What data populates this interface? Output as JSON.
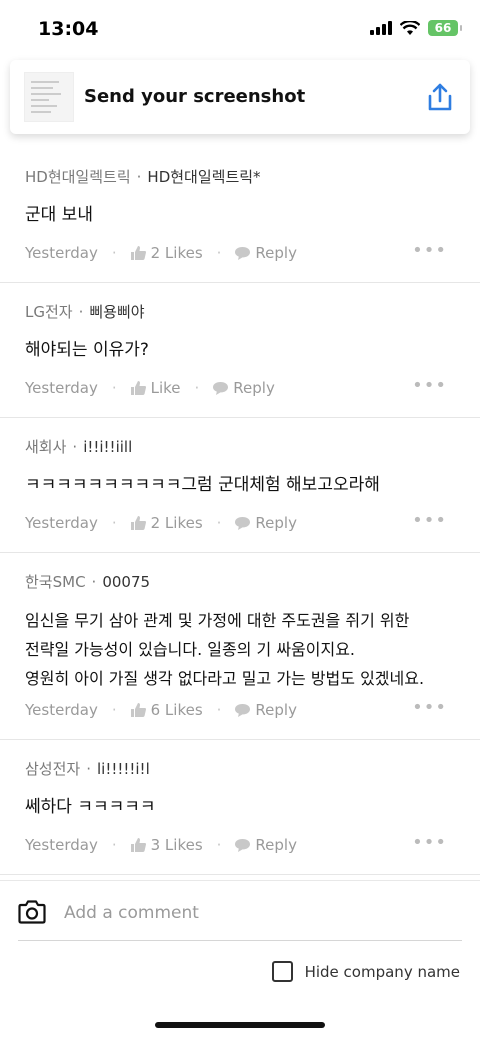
{
  "status": {
    "time": "13:04",
    "battery": "66"
  },
  "header": {
    "title": "Send your screenshot"
  },
  "comments": [
    {
      "company": "HD현대일렉트릭",
      "nickname": "HD현대일렉트릭*",
      "text": "군대 보내",
      "time": "Yesterday",
      "likes": "2 Likes",
      "reply": "Reply"
    },
    {
      "company": "LG전자",
      "nickname": "삐용삐야",
      "text": "해야되는 이유가?",
      "time": "Yesterday",
      "likes": "Like",
      "reply": "Reply"
    },
    {
      "company": "새회사",
      "nickname": "i!!i!!iill",
      "text": "ㅋㅋㅋㅋㅋㅋㅋㅋㅋㅋ그럼 군대체험 해보고오라해",
      "time": "Yesterday",
      "likes": "2 Likes",
      "reply": "Reply"
    },
    {
      "company": "한국SMC",
      "nickname": "00075",
      "text": "임신을 무기 삼아 관계 및 가정에 대한 주도권을 쥐기 위한\n전략일 가능성이 있습니다. 일종의 기 싸움이지요.\n영원히 아이 가질 생각 없다라고 밀고 가는 방법도 있겠네요.",
      "time": "Yesterday",
      "likes": "6 Likes",
      "reply": "Reply"
    },
    {
      "company": "삼성전자",
      "nickname": "li!!!!!i!l",
      "text": "쎄하다 ㅋㅋㅋㅋㅋ",
      "time": "Yesterday",
      "likes": "3 Likes",
      "reply": "Reply"
    }
  ],
  "comment_input": {
    "placeholder": "Add a comment"
  },
  "hide_company": {
    "label": "Hide company name",
    "checked": false
  },
  "icons": [
    "signal-icon",
    "wifi-icon",
    "battery-icon",
    "share-icon",
    "thumbs-up-icon",
    "speech-bubble-icon",
    "more-icon",
    "camera-icon"
  ],
  "colors": {
    "accent": "#2f7de1",
    "battery": "#65c466"
  }
}
